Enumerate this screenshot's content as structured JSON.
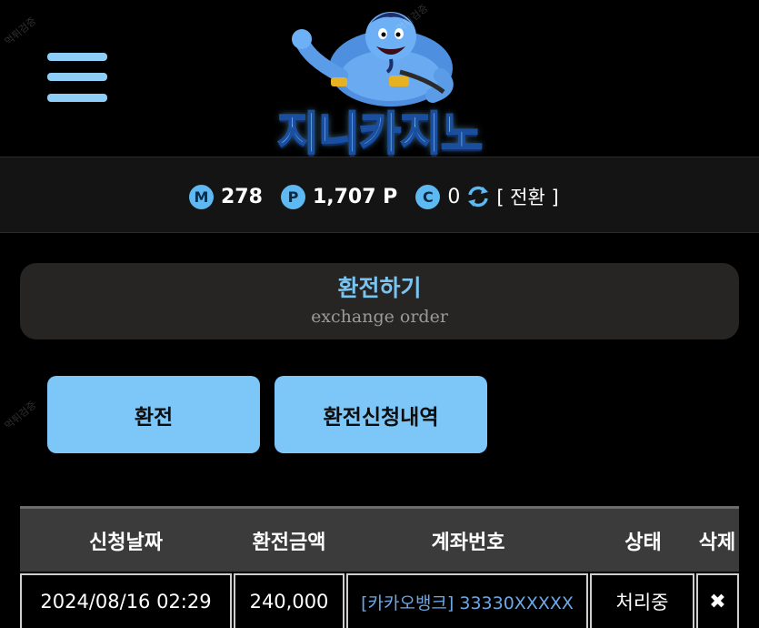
{
  "header": {
    "logo_text": "지니카지노",
    "watermark_text": "먹튀검증"
  },
  "balance": {
    "money_icon": "M",
    "money_value": "278",
    "point_icon": "P",
    "point_value": "1,707 P",
    "coin_icon": "C",
    "coin_value": "0",
    "convert_label": "[ 전환 ]"
  },
  "section": {
    "title": "환전하기",
    "subtitle": "exchange order"
  },
  "tabs": [
    {
      "label": "환전"
    },
    {
      "label": "환전신청내역"
    }
  ],
  "table": {
    "headers": [
      "신청날짜",
      "환전금액",
      "계좌번호",
      "상태",
      "삭제"
    ],
    "rows": [
      {
        "date": "2024/08/16 02:29",
        "amount": "240,000",
        "account": "[카카오뱅크] 33330XXXXX",
        "status": "처리중",
        "delete": "✖"
      }
    ]
  },
  "colors": {
    "accent": "#7cc7f7",
    "title_text": "#7bc4f0",
    "account_link": "#6ea7e6",
    "panel": "#262524",
    "table_header": "#3b3b3b"
  }
}
